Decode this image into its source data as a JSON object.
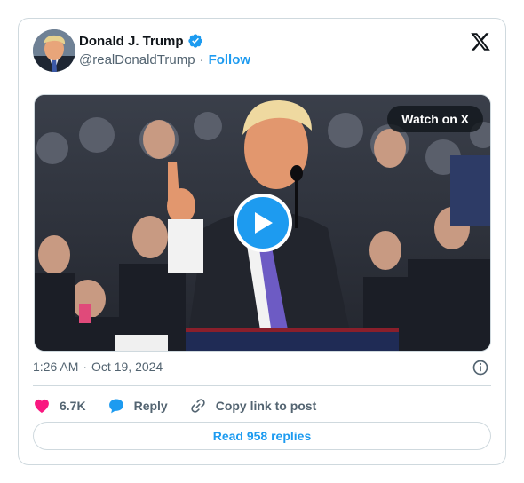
{
  "author": {
    "display_name": "Donald J. Trump",
    "handle": "@realDonaldTrump",
    "separator": "·",
    "follow_label": "Follow",
    "verified": true,
    "avatar_icon": "profile-photo"
  },
  "media": {
    "type": "video",
    "watch_label": "Watch on X",
    "play_icon": "play-icon"
  },
  "meta": {
    "time": "1:26 AM",
    "separator": "·",
    "date": "Oct 19, 2024"
  },
  "actions": {
    "like_count": "6.7K",
    "reply_label": "Reply",
    "copy_link_label": "Copy link to post"
  },
  "replies_button": "Read 958 replies",
  "colors": {
    "accent": "#1d9bf0",
    "like": "#f91880",
    "text": "#0f1419",
    "muted": "#536471",
    "border": "#cfd9de"
  }
}
